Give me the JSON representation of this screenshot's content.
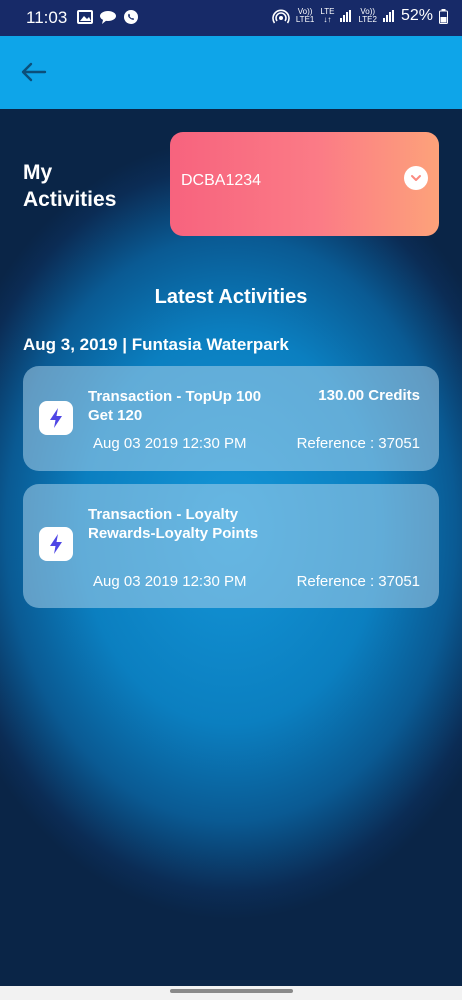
{
  "status_bar": {
    "time": "11:03",
    "signal_labels": [
      "Vo))",
      "LTE1",
      "LTE",
      "Vo))",
      "LTE2"
    ],
    "battery": "52%"
  },
  "header": {
    "back_icon": "arrow-left-icon"
  },
  "page": {
    "title_line1": "My",
    "title_line2": "Activities",
    "card_number": "DCBA1234",
    "section_title": "Latest Activities",
    "date_venue": "Aug 3, 2019 | Funtasia Waterpark"
  },
  "transactions": [
    {
      "title": "Transaction - TopUp 100 Get 120",
      "credits": "130.00 Credits",
      "datetime": "Aug 03 2019 12:30 PM",
      "reference": "Reference : 37051",
      "icon": "lightning-icon"
    },
    {
      "title": "Transaction - Loyalty Rewards-Loyalty Points",
      "credits": "",
      "datetime": "Aug 03 2019 12:30 PM",
      "reference": "Reference : 37051",
      "icon": "lightning-icon"
    }
  ],
  "colors": {
    "status_bar": "#172a68",
    "app_bar": "#0ea5e9",
    "card_gradient_start": "#f7637e",
    "card_gradient_end": "#fda27a",
    "icon_accent": "#4f46e5"
  }
}
